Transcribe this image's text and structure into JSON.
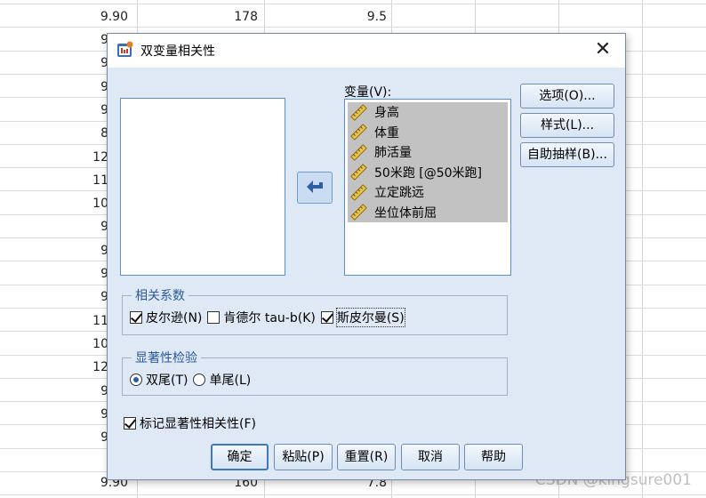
{
  "sheet": {
    "visible_cells": [
      {
        "text": "9.90",
        "col": 0,
        "row": 0
      },
      {
        "text": "178",
        "col": 1,
        "row": 0
      },
      {
        "text": "9.5",
        "col": 2,
        "row": 0
      },
      {
        "text": "9.90",
        "col": 0,
        "row": 20
      },
      {
        "text": "160",
        "col": 1,
        "row": 20
      },
      {
        "text": "7.8",
        "col": 2,
        "row": 20
      }
    ],
    "partial_left_cells": [
      "9",
      "9",
      "9",
      "9",
      "8",
      "12",
      "11",
      "10",
      "9",
      "9",
      "9",
      "9",
      "11",
      "10",
      "12",
      "9",
      "9",
      "9"
    ]
  },
  "dialog": {
    "title": "双变量相关性",
    "close_symbol": "✕",
    "variables_label": "变量(V):",
    "variables": [
      "身高",
      "体重",
      "肺活量",
      "50米跑 [@50米跑]",
      "立定跳远",
      "坐位体前屈"
    ],
    "side_buttons": [
      "选项(O)...",
      "样式(L)...",
      "自助抽样(B)..."
    ],
    "correlation_group": {
      "title": "相关系数",
      "options": [
        {
          "label": "皮尔逊(N)",
          "checked": true
        },
        {
          "label": "肯德尔 tau-b(K)",
          "checked": false
        },
        {
          "label": "斯皮尔曼(S)",
          "checked": true
        }
      ]
    },
    "significance_group": {
      "title": "显著性检验",
      "options": [
        {
          "label": "双尾(T)",
          "selected": true
        },
        {
          "label": "单尾(L)",
          "selected": false
        }
      ]
    },
    "flag_checkbox": {
      "label": "标记显著性相关性(F)",
      "checked": true
    },
    "bottom_buttons": [
      "确定",
      "粘贴(P)",
      "重置(R)",
      "取消",
      "帮助"
    ]
  },
  "watermark": "CSDN @kingsure001",
  "colors": {
    "dialog_bg": "#dfe9f5",
    "group_title": "#2b5a9a",
    "selected_item_bg": "#c2c2c2",
    "button_border": "#6e8eb5"
  }
}
